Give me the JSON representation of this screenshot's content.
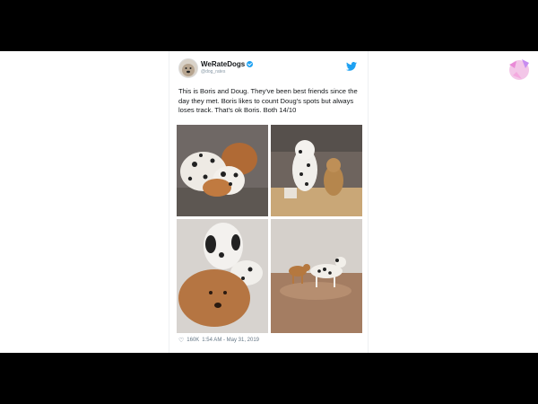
{
  "tweet": {
    "account_name": "WeRateDogs",
    "handle": "@dog_rates",
    "text": "This is Boris and Doug. They've been best friends since the day they met. Boris likes to count Doug's spots but always loses track. That's ok Boris. Both 14/10",
    "likes": "160K",
    "timestamp": "1:54 AM - May 31, 2019"
  },
  "icons": {
    "verified": "verified-badge-icon",
    "twitter": "twitter-bird-icon",
    "like": "heart-icon",
    "channel_logo": "channel-logo-icon"
  },
  "colors": {
    "background_bars": "#000000",
    "accent": "#1da1f2",
    "text_primary": "#14171a",
    "text_secondary": "#657786"
  }
}
